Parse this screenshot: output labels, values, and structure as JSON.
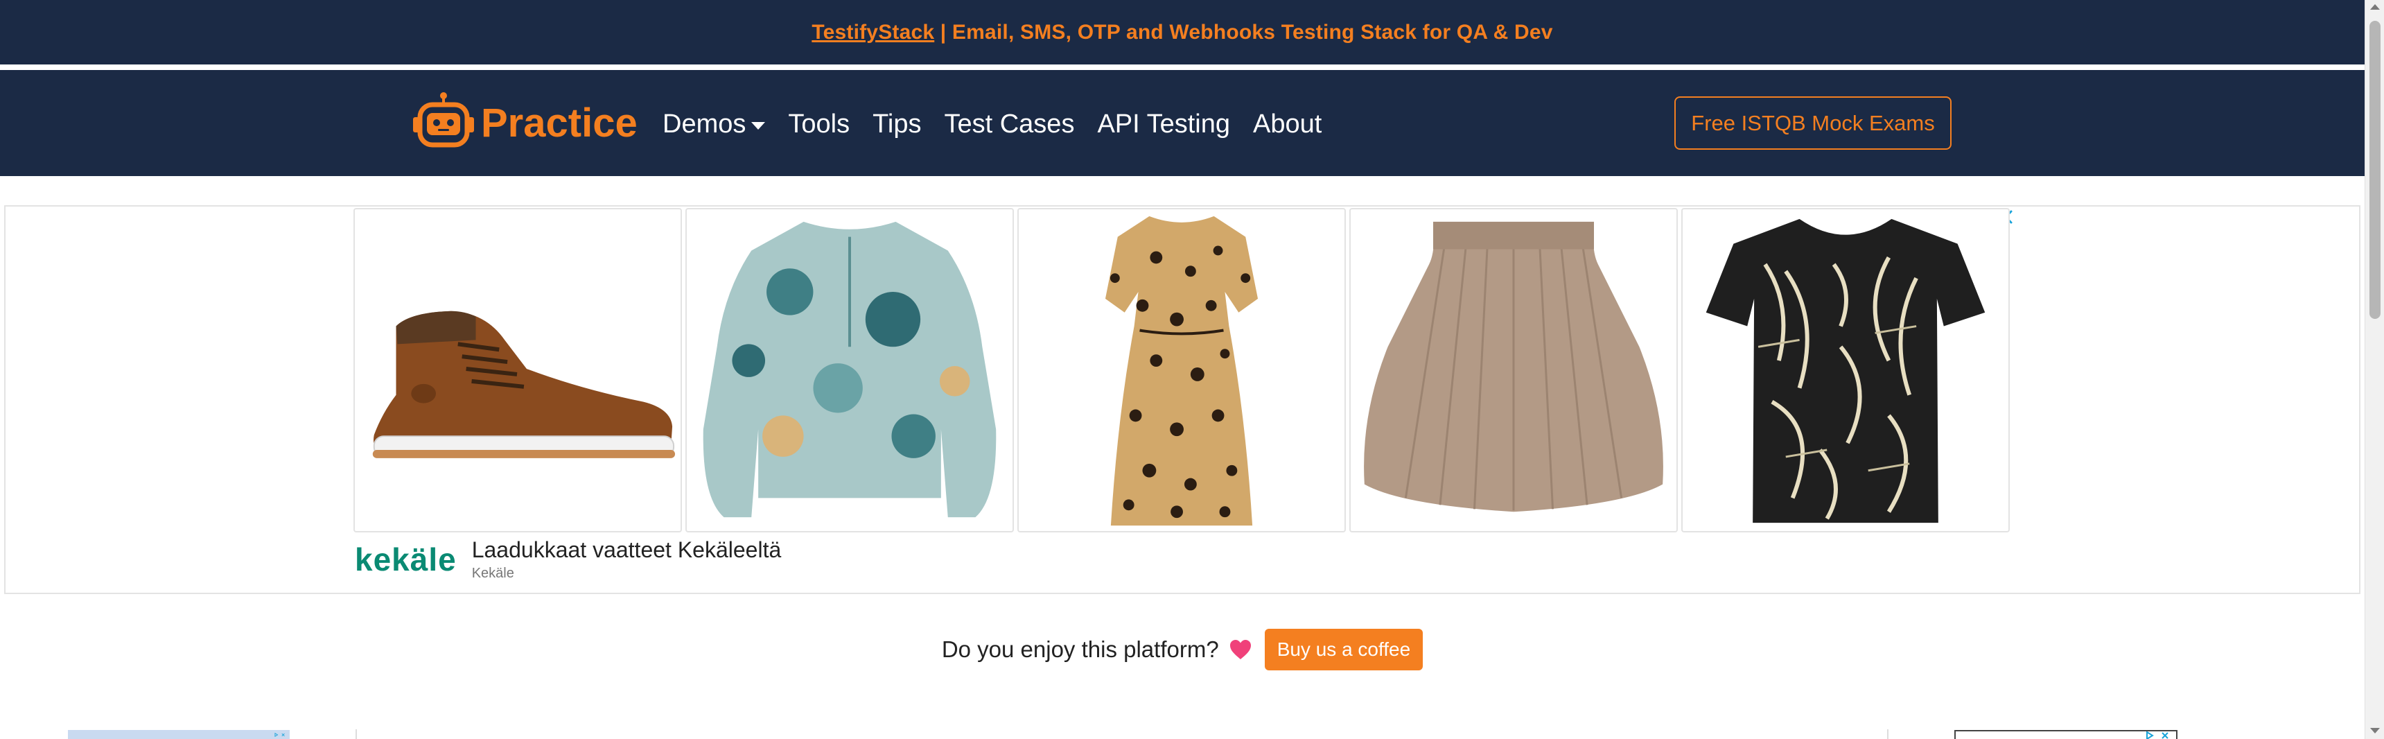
{
  "banner": {
    "link_text": "TestifyStack",
    "rest_text": " | Email, SMS, OTP and Webhooks Testing Stack for QA & Dev"
  },
  "navbar": {
    "brand": "Practice",
    "logo_icon": "robot-icon",
    "links": [
      {
        "label": "Demos",
        "has_dropdown": true
      },
      {
        "label": "Tools"
      },
      {
        "label": "Tips"
      },
      {
        "label": "Test Cases"
      },
      {
        "label": "API Testing"
      },
      {
        "label": "About"
      }
    ],
    "cta_label": "Free ISTQB Mock Exams"
  },
  "ad": {
    "products": [
      {
        "name": "brown-leather-sneaker-boot",
        "icon": "boot-image"
      },
      {
        "name": "floral-print-blouse",
        "icon": "blouse-image"
      },
      {
        "name": "leopard-print-dress",
        "icon": "dress-image"
      },
      {
        "name": "knit-skirt",
        "icon": "skirt-image"
      },
      {
        "name": "leaf-print-tshirt",
        "icon": "tshirt-image"
      }
    ],
    "brand_mark": "kekäle",
    "headline": "Laadukkaat vaatteet Kekäleeltä",
    "source": "Kekäle"
  },
  "support": {
    "text": "Do you enjoy this platform?",
    "button_label": "Buy us a coffee"
  },
  "colors": {
    "navy": "#1b2a45",
    "orange": "#f47f20",
    "teal": "#0a8a73"
  }
}
